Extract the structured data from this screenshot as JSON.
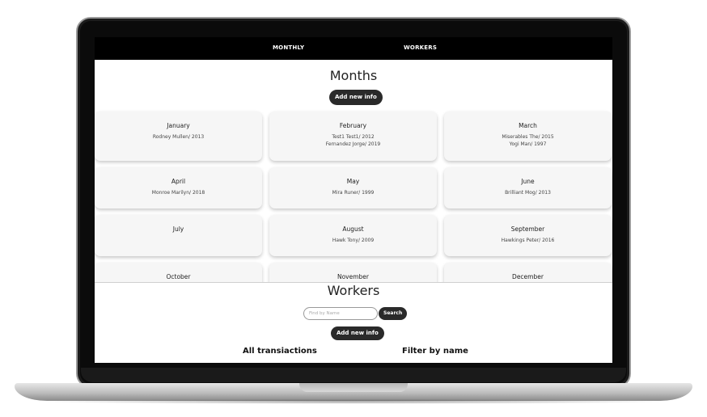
{
  "nav": {
    "monthly": "MONTHLY",
    "workers": "WORKERS"
  },
  "months": {
    "title": "Months",
    "add_label": "Add new info",
    "items": [
      {
        "name": "January",
        "entries": [
          "Rodney Mullen/ 2013"
        ]
      },
      {
        "name": "February",
        "entries": [
          "Test1 Test1/ 2012",
          "Fernandez Jorge/ 2019"
        ]
      },
      {
        "name": "March",
        "entries": [
          "Miserables The/ 2015",
          "Yogi Man/ 1997"
        ]
      },
      {
        "name": "April",
        "entries": [
          "Monroe Marilyn/ 2018"
        ]
      },
      {
        "name": "May",
        "entries": [
          "Mira Runer/ 1999"
        ]
      },
      {
        "name": "June",
        "entries": [
          "Brilliant Mog/ 2013"
        ]
      },
      {
        "name": "July",
        "entries": []
      },
      {
        "name": "August",
        "entries": [
          "Hawk Tony/ 2009"
        ]
      },
      {
        "name": "September",
        "entries": [
          "Hawkings Peter/ 2016"
        ]
      },
      {
        "name": "October",
        "entries": []
      },
      {
        "name": "November",
        "entries": []
      },
      {
        "name": "December",
        "entries": []
      }
    ]
  },
  "workers": {
    "title": "Workers",
    "search_placeholder": "Find by Name",
    "search_label": "Search",
    "add_label": "Add new info",
    "tab_all": "All transiactions",
    "tab_filter": "Filter by name"
  },
  "colors": {
    "nav_bg": "#000000",
    "card_bg": "#f6f6f6",
    "button_bg": "#2a2a2a"
  }
}
